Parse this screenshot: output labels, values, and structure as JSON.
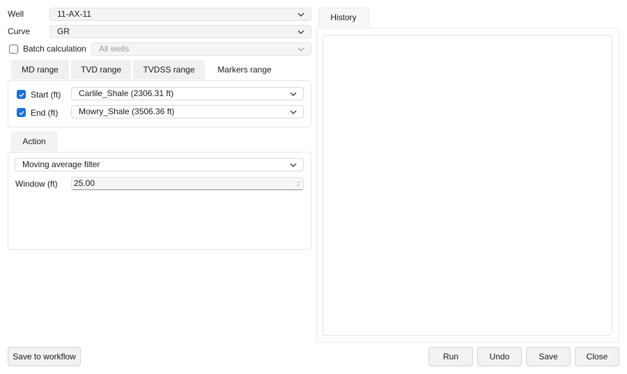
{
  "well": {
    "label": "Well",
    "value": "11-AX-11"
  },
  "curve": {
    "label": "Curve",
    "value": "GR"
  },
  "batch": {
    "label": "Batch calculation",
    "checked": false,
    "value": "All wells"
  },
  "range_tabs": [
    {
      "label": "MD range",
      "active": false
    },
    {
      "label": "TVD range",
      "active": false
    },
    {
      "label": "TVDSS range",
      "active": false
    },
    {
      "label": "Markers range",
      "active": true
    }
  ],
  "markers": {
    "start": {
      "label": "Start (ft)",
      "checked": true,
      "value": "Carlile_Shale (2306.31 ft)"
    },
    "end": {
      "label": "End (ft)",
      "checked": true,
      "value": "Mowry_Shale (3506.36 ft)"
    }
  },
  "action": {
    "tab_label": "Action",
    "method": "Moving average filter",
    "window_label": "Window (ft)",
    "window_value": "25.00"
  },
  "history": {
    "tab_label": "History"
  },
  "buttons": {
    "save_workflow": "Save to workflow",
    "run": "Run",
    "undo": "Undo",
    "save": "Save",
    "close": "Close"
  },
  "colors": {
    "accent": "#1d6fd6"
  }
}
